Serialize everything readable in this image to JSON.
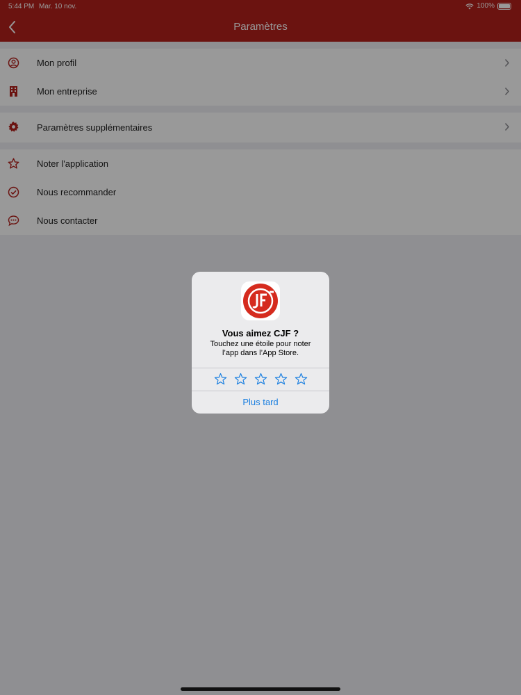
{
  "status_bar": {
    "time": "5:44 PM",
    "date": "Mar. 10 nov.",
    "battery": "100%"
  },
  "nav": {
    "title": "Paramètres",
    "back_icon": "chevron-left-icon"
  },
  "settings": {
    "groups": [
      {
        "items": [
          {
            "label": "Mon profil",
            "icon": "user-circle-icon",
            "chevron": true
          },
          {
            "label": "Mon entreprise",
            "icon": "building-icon",
            "chevron": true
          }
        ]
      },
      {
        "items": [
          {
            "label": "Paramètres supplémentaires",
            "icon": "gear-icon",
            "chevron": true
          }
        ]
      },
      {
        "items": [
          {
            "label": "Noter l'application",
            "icon": "star-icon",
            "chevron": false
          },
          {
            "label": "Nous recommander",
            "icon": "check-circle-icon",
            "chevron": false
          },
          {
            "label": "Nous contacter",
            "icon": "chat-bubble-icon",
            "chevron": false
          }
        ]
      }
    ]
  },
  "rating_alert": {
    "app_icon": "cjf-logo-icon",
    "title": "Vous aimez CJF ?",
    "message": "Touchez une étoile pour noter l’app dans l’App Store.",
    "star_count": 5,
    "later_label": "Plus tard"
  },
  "colors": {
    "brand_red": "#b3211c",
    "alert_link_blue": "#1a7fe0",
    "icon_red": "#b3211c"
  }
}
